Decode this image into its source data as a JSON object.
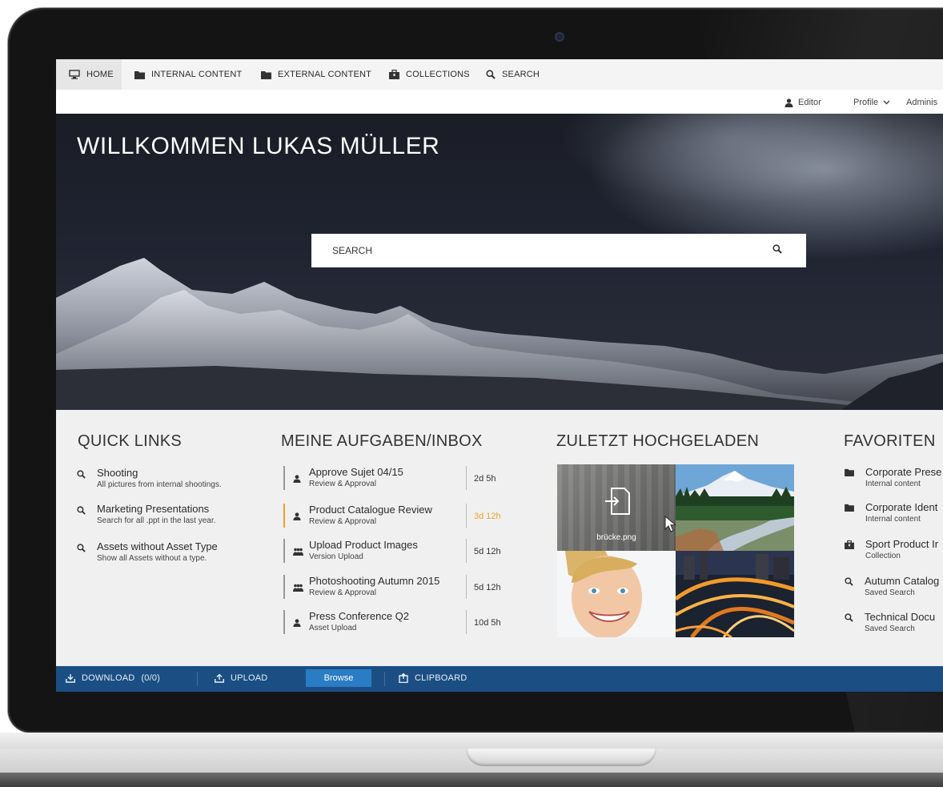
{
  "nav": {
    "items": [
      {
        "label": "HOME",
        "icon": "monitor-icon"
      },
      {
        "label": "INTERNAL CONTENT",
        "icon": "folder-icon"
      },
      {
        "label": "EXTERNAL CONTENT",
        "icon": "folder-icon"
      },
      {
        "label": "COLLECTIONS",
        "icon": "briefcase-icon"
      },
      {
        "label": "SEARCH",
        "icon": "search-icon"
      }
    ]
  },
  "subnav": {
    "role": "Editor",
    "profile": "Profile",
    "admin": "Adminis"
  },
  "hero": {
    "title": "WILLKOMMEN LUKAS MÜLLER",
    "search_placeholder": "SEARCH"
  },
  "quick_links": {
    "title": "QUICK LINKS",
    "items": [
      {
        "title": "Shooting",
        "subtitle": "All pictures from internal shootings."
      },
      {
        "title": "Marketing Presentations",
        "subtitle": "Search for all .ppt in the last year."
      },
      {
        "title": "Assets without Asset Type",
        "subtitle": "Show all Assets without a type."
      }
    ]
  },
  "tasks": {
    "title": "MEINE AUFGABEN/INBOX",
    "items": [
      {
        "title": "Approve Sujet 04/15",
        "subtitle": "Review & Approval",
        "duration": "2d 5h",
        "highlight": false,
        "icon": "user-icon"
      },
      {
        "title": "Product Catalogue Review",
        "subtitle": "Review & Approval",
        "duration": "3d 12h",
        "highlight": true,
        "icon": "user-icon"
      },
      {
        "title": "Upload Product Images",
        "subtitle": "Version Upload",
        "duration": "5d 12h",
        "highlight": false,
        "icon": "group-icon"
      },
      {
        "title": "Photoshooting Autumn 2015",
        "subtitle": "Review & Approval",
        "duration": "5d 12h",
        "highlight": false,
        "icon": "group-icon"
      },
      {
        "title": "Press Conference Q2",
        "subtitle": "Asset Upload",
        "duration": "10d 5h",
        "highlight": false,
        "icon": "user-icon"
      }
    ]
  },
  "recent": {
    "title": "ZULETZT HOCHGELADEN",
    "upload_filename": "brücke.png"
  },
  "favorites": {
    "title": "FAVORITEN",
    "items": [
      {
        "title": "Corporate Prese",
        "subtitle": "Internal content",
        "icon": "folder-icon"
      },
      {
        "title": "Corporate Ident",
        "subtitle": "Internal content",
        "icon": "folder-icon"
      },
      {
        "title": "Sport Product Ir",
        "subtitle": "Collection",
        "icon": "briefcase-icon"
      },
      {
        "title": "Autumn Catalog",
        "subtitle": "Saved Search",
        "icon": "search-icon"
      },
      {
        "title": "Technical Docu",
        "subtitle": "Saved Search",
        "icon": "search-icon"
      }
    ]
  },
  "bottombar": {
    "download": "DOWNLOAD",
    "download_count": "(0/0)",
    "upload": "UPLOAD",
    "browse": "Browse",
    "clipboard": "CLIPBOARD"
  },
  "colors": {
    "accent": "#f0a030",
    "bottombar": "#1b4f84",
    "browse": "#2a7cc4"
  }
}
